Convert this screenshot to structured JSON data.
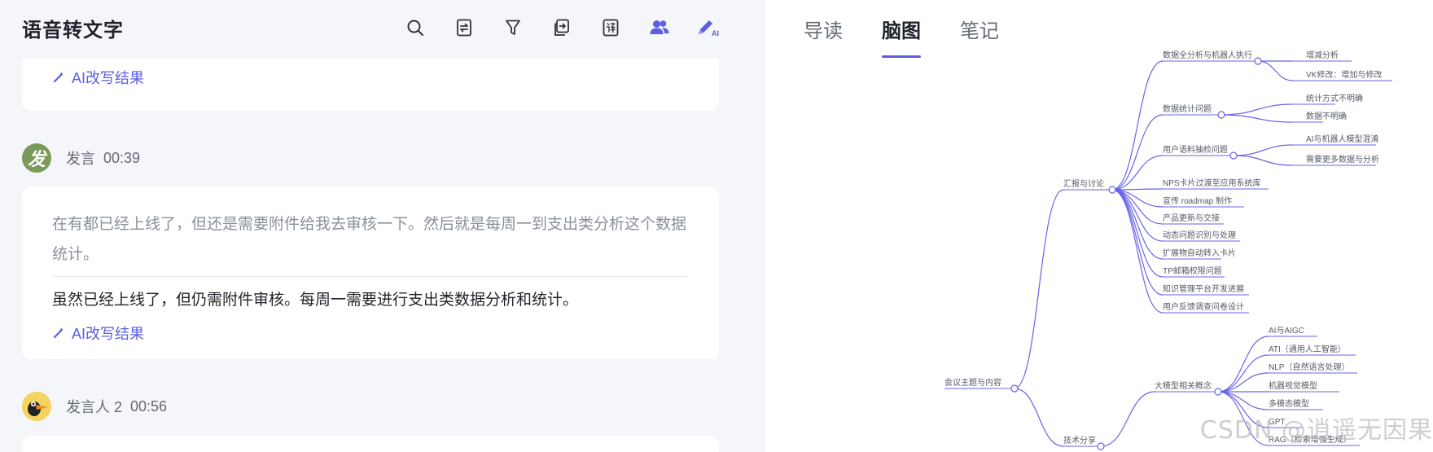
{
  "app": {
    "title": "语音转文字"
  },
  "toolbar": {
    "icons": [
      "search-icon",
      "swap-icon",
      "filter-icon",
      "export-icon",
      "translate-icon",
      "speakers-icon",
      "ai-pen-icon"
    ],
    "ai_badge": "AI"
  },
  "transcript": {
    "rewrite_label": "AI改写结果",
    "entries": [
      {
        "speaker": "发言",
        "avatar_text": "发",
        "time": "00:39",
        "original": "在有都已经上线了，但还是需要附件给我去审核一下。然后就是每周一到支出类分析这个数据统计。",
        "rewritten": "虽然已经上线了，但仍需附件审核。每周一需要进行支出类数据分析和统计。"
      },
      {
        "speaker": "发言人 2",
        "time": "00:56"
      }
    ]
  },
  "right_panel": {
    "tabs": [
      {
        "label": "导读",
        "active": false
      },
      {
        "label": "脑图",
        "active": true
      },
      {
        "label": "笔记",
        "active": false
      }
    ],
    "accent": "#5b5ee0"
  },
  "mindmap": {
    "root": "会议主题与内容",
    "branch_report": "汇报与讨论",
    "branch_tech": "技术分享",
    "report_items": [
      "数据全分析与机器人执行",
      "数据统计问题",
      "用户语料抽检问题",
      "NPS卡片过渡至应用系统库",
      "宣传 roadmap 制作",
      "产品更新与交接",
      "动态问题识别与处理",
      "扩展物自动转入卡片",
      "TP邮箱权限问题",
      "知识管理平台开发进展",
      "用户反馈调查问卷设计"
    ],
    "sub_first": [
      "增减分析",
      "VK修改：增加与修改"
    ],
    "sub_stats": [
      "统计方式不明确",
      "数据不明确"
    ],
    "sub_corpus": [
      "AI与机器人模型混淆",
      "需要更多数据与分析"
    ],
    "tech_concepts": "大模型相关概念",
    "concepts": [
      "AI与AIGC",
      "ATI（通用人工智能）",
      "NLP（自然语言处理）",
      "机器视觉模型",
      "多模态模型",
      "GPT",
      "RAG（检索增强生成）"
    ]
  },
  "watermark": "CSDN @逍遥无因果"
}
